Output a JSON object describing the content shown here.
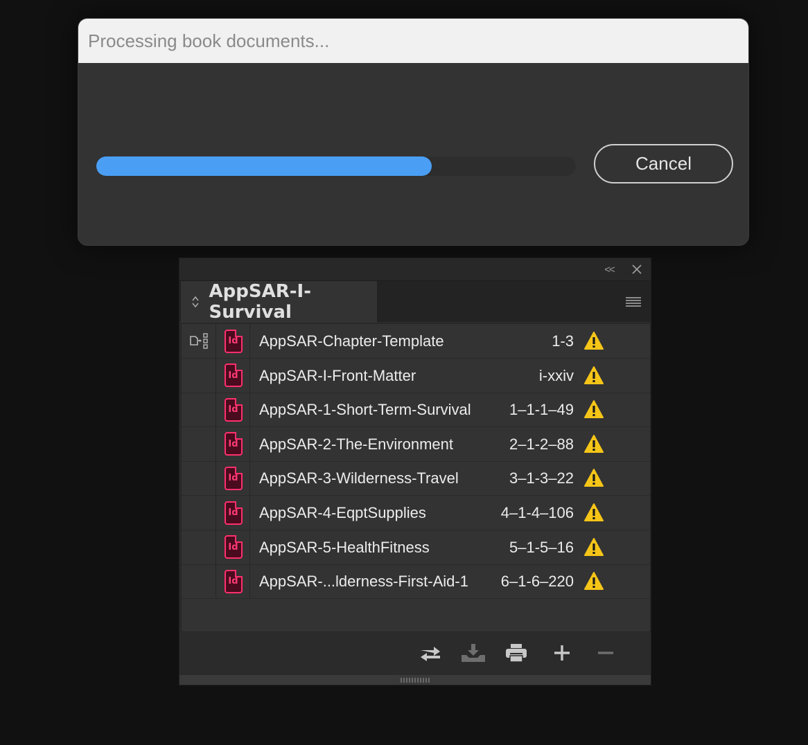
{
  "dialog": {
    "title": "Processing book documents...",
    "progress_percent": 70,
    "cancel_label": "Cancel",
    "progress_color": "#4a9ff5"
  },
  "panel": {
    "book_title": "AppSAR-I-Survival",
    "collapse_label": "<<",
    "documents": [
      {
        "name": "AppSAR-Chapter-Template",
        "pages": "1-3",
        "style_source": true,
        "warning": true
      },
      {
        "name": "AppSAR-I-Front-Matter",
        "pages": "i-xxiv",
        "style_source": false,
        "warning": true
      },
      {
        "name": "AppSAR-1-Short-Term-Survival",
        "pages": "1–1-1–49",
        "style_source": false,
        "warning": true
      },
      {
        "name": "AppSAR-2-The-Environment",
        "pages": "2–1-2–88",
        "style_source": false,
        "warning": true
      },
      {
        "name": "AppSAR-3-Wilderness-Travel",
        "pages": "3–1-3–22",
        "style_source": false,
        "warning": true
      },
      {
        "name": "AppSAR-4-EqptSupplies",
        "pages": "4–1-4–106",
        "style_source": false,
        "warning": true
      },
      {
        "name": "AppSAR-5-HealthFitness",
        "pages": "5–1-5–16",
        "style_source": false,
        "warning": true
      },
      {
        "name": "AppSAR-...lderness-First-Aid-1",
        "pages": "6–1-6–220",
        "style_source": false,
        "warning": true
      }
    ],
    "doc_icon_label": "Id",
    "icon_colors": {
      "indesign": "#ff2f6d",
      "warning": "#f5c518"
    },
    "toolbar": [
      "synchronize-icon",
      "save-book-icon",
      "print-book-icon",
      "add-document-icon",
      "remove-document-icon"
    ]
  }
}
